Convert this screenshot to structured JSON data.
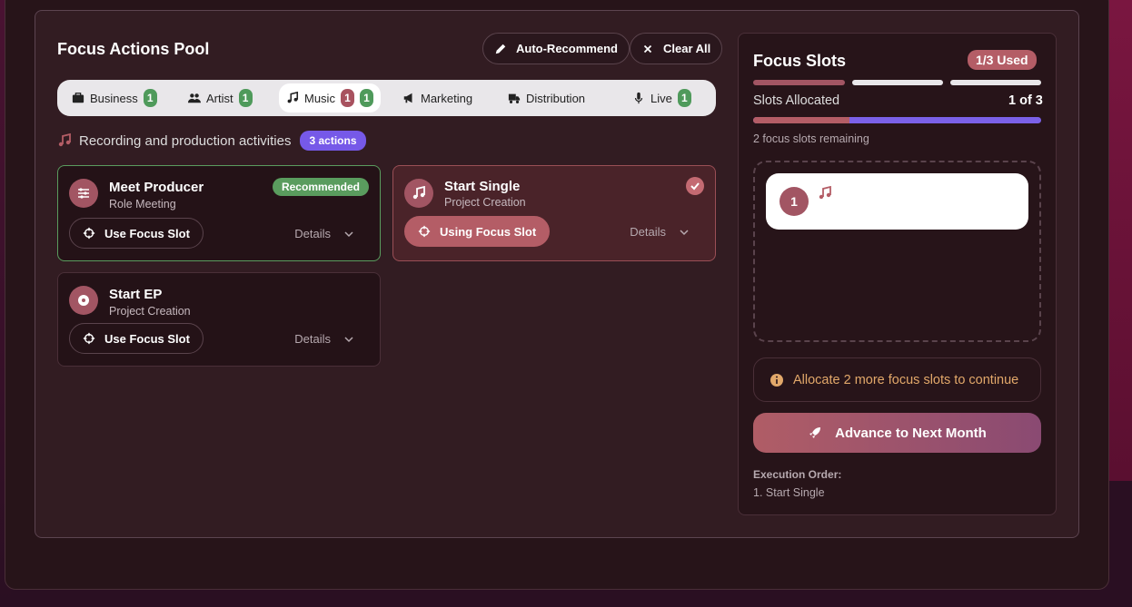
{
  "pool": {
    "title": "Focus Actions Pool",
    "auto_recommend": "Auto-Recommend",
    "clear_all": "Clear All"
  },
  "tabs": [
    {
      "label": "Business",
      "icon": "briefcase-icon",
      "counts": [
        "1"
      ]
    },
    {
      "label": "Artist",
      "icon": "users-icon",
      "counts": [
        "1"
      ]
    },
    {
      "label": "Music",
      "icon": "music-note-icon",
      "counts": [
        "1",
        "1"
      ],
      "active": true
    },
    {
      "label": "Marketing",
      "icon": "megaphone-icon",
      "counts": []
    },
    {
      "label": "Distribution",
      "icon": "truck-icon",
      "counts": []
    },
    {
      "label": "Live",
      "icon": "microphone-icon",
      "counts": [
        "1"
      ]
    }
  ],
  "category": {
    "text": "Recording and production activities",
    "badge": "3 actions"
  },
  "cards": [
    {
      "title": "Meet Producer",
      "subtitle": "Role Meeting",
      "badge": "Recommended",
      "action": "Use Focus Slot",
      "details": "Details",
      "icon": "sliders-icon"
    },
    {
      "title": "Start Single",
      "subtitle": "Project Creation",
      "action": "Using Focus Slot",
      "details": "Details",
      "icon": "music-note-icon",
      "selected": true
    },
    {
      "title": "Start EP",
      "subtitle": "Project Creation",
      "action": "Use Focus Slot",
      "details": "Details",
      "icon": "disc-icon"
    }
  ],
  "slots": {
    "title": "Focus Slots",
    "used_badge": "1/3 Used",
    "allocated_label": "Slots Allocated",
    "allocated_value": "1 of 3",
    "allocated_fraction": 0.333,
    "remaining": "2 focus slots remaining",
    "slot_number": "1",
    "alert": "Allocate 2 more focus slots to continue",
    "advance": "Advance to Next Month",
    "exec_label": "Execution Order:",
    "exec_item": "1. Start Single"
  },
  "colors": {
    "accent": "#b45d66",
    "success": "#5a9c5e",
    "purple": "#7659e8",
    "warning": "#e2a86a"
  }
}
